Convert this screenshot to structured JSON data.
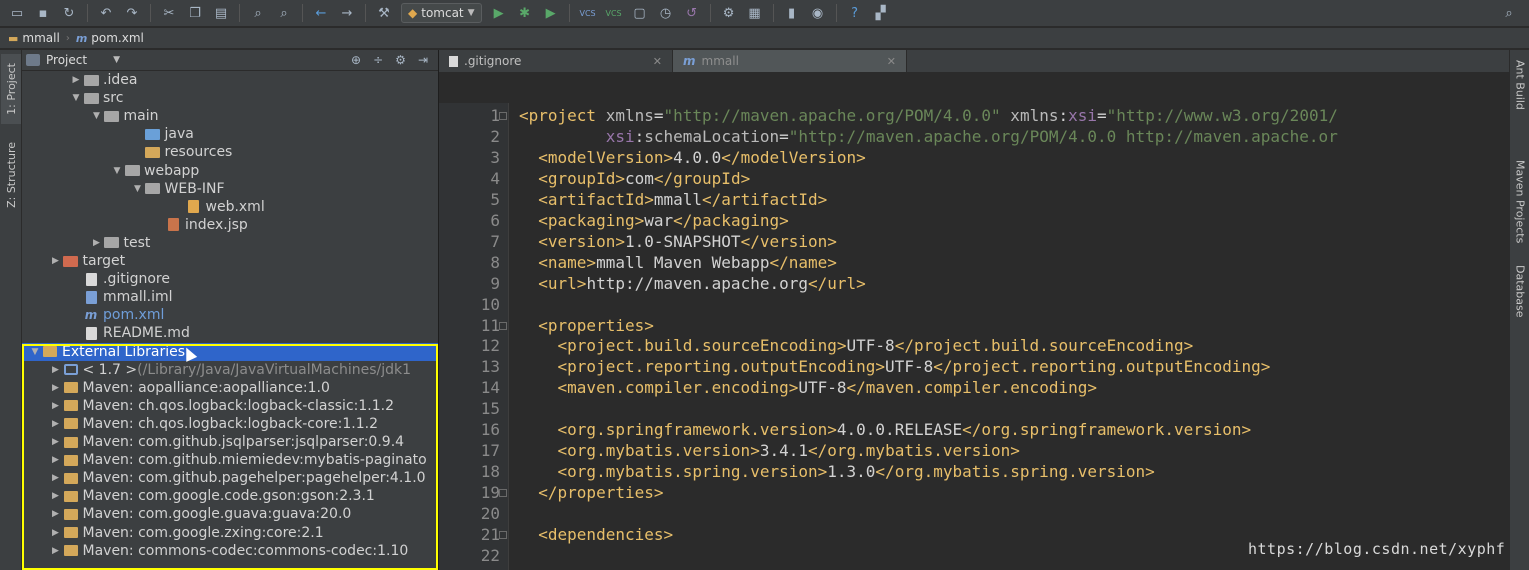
{
  "toolbar": {
    "icons": [
      "open-folder-icon",
      "save-icon",
      "sync-icon",
      "undo-icon",
      "redo-icon",
      "cut-icon",
      "copy-icon",
      "paste-icon",
      "find-icon",
      "replace-icon",
      "back-icon",
      "forward-icon",
      "build-icon",
      "run-icon",
      "debug-icon",
      "coverage-icon",
      "vcs-update-icon",
      "vcs-commit-icon",
      "vcs-icon",
      "history-icon",
      "revert-icon",
      "settings-icon",
      "project-structure-icon",
      "sdk-icon",
      "android-icon",
      "help-icon",
      "search-everywhere-icon"
    ],
    "run_config": "tomcat"
  },
  "breadcrumb": {
    "project": "mmall",
    "file": "pom.xml"
  },
  "left_strip": {
    "project_tab": "1: Project",
    "structure_tab": "Z: Structure"
  },
  "project_panel": {
    "view": "Project",
    "tree": [
      {
        "label": "idea",
        "text": ".idea",
        "indent": 2,
        "toggle": "▶",
        "icon": "folder"
      },
      {
        "label": "src",
        "text": "src",
        "indent": 2,
        "toggle": "▼",
        "icon": "folder"
      },
      {
        "label": "main",
        "text": "main",
        "indent": 3,
        "toggle": "▼",
        "icon": "folder"
      },
      {
        "label": "java",
        "text": "java",
        "indent": 5,
        "toggle": "",
        "icon": "folder-blue"
      },
      {
        "label": "resources",
        "text": "resources",
        "indent": 5,
        "toggle": "",
        "icon": "folder-res"
      },
      {
        "label": "webapp",
        "text": "webapp",
        "indent": 4,
        "toggle": "▼",
        "icon": "folder"
      },
      {
        "label": "web-inf",
        "text": "WEB-INF",
        "indent": 5,
        "toggle": "▼",
        "icon": "folder"
      },
      {
        "label": "web-xml",
        "text": "web.xml",
        "indent": 7,
        "toggle": "",
        "icon": "xml"
      },
      {
        "label": "index-jsp",
        "text": "index.jsp",
        "indent": 6,
        "toggle": "",
        "icon": "jsp"
      },
      {
        "label": "test",
        "text": "test",
        "indent": 3,
        "toggle": "▶",
        "icon": "folder"
      },
      {
        "label": "target",
        "text": "target",
        "indent": 1,
        "toggle": "▶",
        "icon": "folder-red"
      },
      {
        "label": "gitignore",
        "text": ".gitignore",
        "indent": 2,
        "toggle": "",
        "icon": "file"
      },
      {
        "label": "mmall-iml",
        "text": "mmall.iml",
        "indent": 2,
        "toggle": "",
        "icon": "iml"
      },
      {
        "label": "pom-xml",
        "text": "pom.xml",
        "indent": 2,
        "toggle": "",
        "icon": "m",
        "color": "blue"
      },
      {
        "label": "readme",
        "text": "README.md",
        "indent": 2,
        "toggle": "",
        "icon": "file"
      },
      {
        "label": "external-libraries",
        "text": "External Libraries",
        "indent": 0,
        "toggle": "▼",
        "icon": "lib",
        "selected": true
      },
      {
        "label": "jdk",
        "text": "< 1.7 >",
        "extra": " (/Library/Java/JavaVirtualMachines/jdk1",
        "indent": 1,
        "toggle": "▶",
        "icon": "jdk"
      },
      {
        "label": "lib-aopalliance",
        "text": "Maven: aopalliance:aopalliance:1.0",
        "indent": 1,
        "toggle": "▶",
        "icon": "lib"
      },
      {
        "label": "lib-logback-classic",
        "text": "Maven: ch.qos.logback:logback-classic:1.1.2",
        "indent": 1,
        "toggle": "▶",
        "icon": "lib"
      },
      {
        "label": "lib-logback-core",
        "text": "Maven: ch.qos.logback:logback-core:1.1.2",
        "indent": 1,
        "toggle": "▶",
        "icon": "lib"
      },
      {
        "label": "lib-jsqlparser",
        "text": "Maven: com.github.jsqlparser:jsqlparser:0.9.4",
        "indent": 1,
        "toggle": "▶",
        "icon": "lib"
      },
      {
        "label": "lib-mybatis-paginator",
        "text": "Maven: com.github.miemiedev:mybatis-paginato",
        "indent": 1,
        "toggle": "▶",
        "icon": "lib"
      },
      {
        "label": "lib-pagehelper",
        "text": "Maven: com.github.pagehelper:pagehelper:4.1.0",
        "indent": 1,
        "toggle": "▶",
        "icon": "lib"
      },
      {
        "label": "lib-gson",
        "text": "Maven: com.google.code.gson:gson:2.3.1",
        "indent": 1,
        "toggle": "▶",
        "icon": "lib"
      },
      {
        "label": "lib-guava",
        "text": "Maven: com.google.guava:guava:20.0",
        "indent": 1,
        "toggle": "▶",
        "icon": "lib"
      },
      {
        "label": "lib-zxing",
        "text": "Maven: com.google.zxing:core:2.1",
        "indent": 1,
        "toggle": "▶",
        "icon": "lib"
      },
      {
        "label": "lib-commons-codec",
        "text": "Maven: commons-codec:commons-codec:1.10",
        "indent": 1,
        "toggle": "▶",
        "icon": "lib"
      }
    ]
  },
  "editor": {
    "tabs": [
      {
        "label": ".gitignore",
        "active": false
      },
      {
        "label": "mmall",
        "active": true
      }
    ],
    "lines": [
      [
        [
          "t",
          "<project "
        ],
        [
          "a",
          "xmlns"
        ],
        [
          "v",
          "="
        ],
        [
          "s",
          "\"http://maven.apache.org/POM/4.0.0\""
        ],
        [
          "a",
          " xmlns"
        ],
        [
          "v",
          ":"
        ],
        [
          "ns",
          "xsi"
        ],
        [
          "v",
          "="
        ],
        [
          "s",
          "\"http://www.w3.org/2001/"
        ]
      ],
      [
        [
          "a",
          "         "
        ],
        [
          "ns",
          "xsi"
        ],
        [
          "v",
          ":"
        ],
        [
          "a",
          "schemaLocation"
        ],
        [
          "v",
          "="
        ],
        [
          "s",
          "\"http://maven.apache.org/POM/4.0.0 http://maven.apache.or"
        ]
      ],
      [
        [
          "t",
          "  <modelVersion>"
        ],
        [
          "v",
          "4.0.0"
        ],
        [
          "t",
          "</modelVersion>"
        ]
      ],
      [
        [
          "t",
          "  <groupId>"
        ],
        [
          "v",
          "com"
        ],
        [
          "t",
          "</groupId>"
        ]
      ],
      [
        [
          "t",
          "  <artifactId>"
        ],
        [
          "v",
          "mmall"
        ],
        [
          "t",
          "</artifactId>"
        ]
      ],
      [
        [
          "t",
          "  <packaging>"
        ],
        [
          "v",
          "war"
        ],
        [
          "t",
          "</packaging>"
        ]
      ],
      [
        [
          "t",
          "  <version>"
        ],
        [
          "v",
          "1.0-SNAPSHOT"
        ],
        [
          "t",
          "</version>"
        ]
      ],
      [
        [
          "t",
          "  <name>"
        ],
        [
          "v",
          "mmall Maven Webapp"
        ],
        [
          "t",
          "</name>"
        ]
      ],
      [
        [
          "t",
          "  <url>"
        ],
        [
          "v",
          "http://maven.apache.org"
        ],
        [
          "t",
          "</url>"
        ]
      ],
      [
        [
          "v",
          ""
        ]
      ],
      [
        [
          "t",
          "  <properties>"
        ]
      ],
      [
        [
          "t",
          "    <project.build.sourceEncoding>"
        ],
        [
          "v",
          "UTF-8"
        ],
        [
          "t",
          "</project.build.sourceEncoding>"
        ]
      ],
      [
        [
          "t",
          "    <project.reporting.outputEncoding>"
        ],
        [
          "v",
          "UTF-8"
        ],
        [
          "t",
          "</project.reporting.outputEncoding>"
        ]
      ],
      [
        [
          "t",
          "    <maven.compiler.encoding>"
        ],
        [
          "v",
          "UTF-8"
        ],
        [
          "t",
          "</maven.compiler.encoding>"
        ]
      ],
      [
        [
          "v",
          ""
        ]
      ],
      [
        [
          "t",
          "    <org.springframework.version>"
        ],
        [
          "v",
          "4.0.0.RELEASE"
        ],
        [
          "t",
          "</org.springframework.version>"
        ]
      ],
      [
        [
          "t",
          "    <org.mybatis.version>"
        ],
        [
          "v",
          "3.4.1"
        ],
        [
          "t",
          "</org.mybatis.version>"
        ]
      ],
      [
        [
          "t",
          "    <org.mybatis.spring.version>"
        ],
        [
          "v",
          "1.3.0"
        ],
        [
          "t",
          "</org.mybatis.spring.version>"
        ]
      ],
      [
        [
          "t",
          "  </properties>"
        ]
      ],
      [
        [
          "v",
          ""
        ]
      ],
      [
        [
          "t",
          "  <dependencies>"
        ]
      ],
      [
        [
          "v",
          ""
        ]
      ]
    ],
    "line_numbers": [
      "1",
      "2",
      "3",
      "4",
      "5",
      "6",
      "7",
      "8",
      "9",
      "10",
      "11",
      "12",
      "13",
      "14",
      "15",
      "16",
      "17",
      "18",
      "19",
      "20",
      "21",
      "22"
    ]
  },
  "right_strip": {
    "ant_build": "Ant Build",
    "maven_projects": "Maven Projects",
    "database": "Database"
  },
  "watermark": "https://blog.csdn.net/xyphf"
}
